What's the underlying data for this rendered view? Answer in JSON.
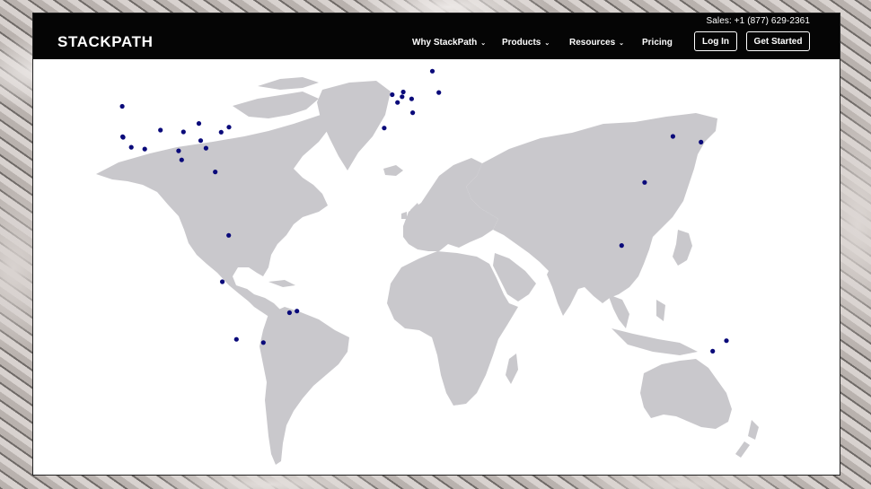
{
  "header": {
    "sales": "Sales: +1 (877) 629-2361",
    "logo": "STACKPATH",
    "nav": [
      {
        "label": "Why StackPath",
        "dropdown": true
      },
      {
        "label": "Products",
        "dropdown": true
      },
      {
        "label": "Resources",
        "dropdown": true
      },
      {
        "label": "Pricing",
        "dropdown": false
      }
    ],
    "login_label": "Log In",
    "cta_label": "Get Started"
  },
  "map": {
    "land_color": "#c9c8cc",
    "marker_color": "#0a0a7a",
    "markers": [
      {
        "name": "seattle",
        "lat": 47.6,
        "lon": -122.3
      },
      {
        "name": "san-jose",
        "lat": 37.3,
        "lon": -121.9
      },
      {
        "name": "palo-alto",
        "lat": 37.5,
        "lon": -122.1
      },
      {
        "name": "los-angeles",
        "lat": 34.0,
        "lon": -118.2
      },
      {
        "name": "phoenix",
        "lat": 33.4,
        "lon": -112.1
      },
      {
        "name": "denver",
        "lat": 39.7,
        "lon": -105.0
      },
      {
        "name": "dallas",
        "lat": 32.8,
        "lon": -96.8
      },
      {
        "name": "kansas-city",
        "lat": 39.1,
        "lon": -94.6
      },
      {
        "name": "houston",
        "lat": 29.8,
        "lon": -95.4
      },
      {
        "name": "chicago",
        "lat": 41.9,
        "lon": -87.6
      },
      {
        "name": "atlanta",
        "lat": 33.7,
        "lon": -84.4
      },
      {
        "name": "nashville",
        "lat": 36.2,
        "lon": -86.8
      },
      {
        "name": "ashburn",
        "lat": 39.0,
        "lon": -77.5
      },
      {
        "name": "new-york",
        "lat": 40.7,
        "lon": -74.0
      },
      {
        "name": "miami",
        "lat": 25.8,
        "lon": -80.2
      },
      {
        "name": "bogota",
        "lat": 4.7,
        "lon": -74.1
      },
      {
        "name": "lima",
        "lat": -12.0,
        "lon": -77.0
      },
      {
        "name": "rio-de-janeiro",
        "lat": -22.9,
        "lon": -43.2
      },
      {
        "name": "sao-paulo",
        "lat": -23.5,
        "lon": -46.6
      },
      {
        "name": "santiago",
        "lat": -33.4,
        "lon": -70.6
      },
      {
        "name": "buenos-aires",
        "lat": -34.6,
        "lon": -58.4
      },
      {
        "name": "london",
        "lat": 51.5,
        "lon": -0.1
      },
      {
        "name": "paris",
        "lat": 48.9,
        "lon": 2.3
      },
      {
        "name": "amsterdam",
        "lat": 52.4,
        "lon": 4.9
      },
      {
        "name": "brussels",
        "lat": 50.8,
        "lon": 4.4
      },
      {
        "name": "frankfurt",
        "lat": 50.1,
        "lon": 8.7
      },
      {
        "name": "milan",
        "lat": 45.5,
        "lon": 9.2
      },
      {
        "name": "madrid",
        "lat": 40.4,
        "lon": -3.7
      },
      {
        "name": "stockholm",
        "lat": 59.3,
        "lon": 18.1
      },
      {
        "name": "warsaw",
        "lat": 52.2,
        "lon": 21.0
      },
      {
        "name": "seoul",
        "lat": 37.6,
        "lon": 127.0
      },
      {
        "name": "tokyo",
        "lat": 35.7,
        "lon": 139.7
      },
      {
        "name": "hong-kong",
        "lat": 22.3,
        "lon": 114.2
      },
      {
        "name": "singapore",
        "lat": 1.3,
        "lon": 103.8
      },
      {
        "name": "melbourne",
        "lat": -37.8,
        "lon": 145.0
      },
      {
        "name": "sydney",
        "lat": -33.9,
        "lon": 151.2
      }
    ]
  }
}
